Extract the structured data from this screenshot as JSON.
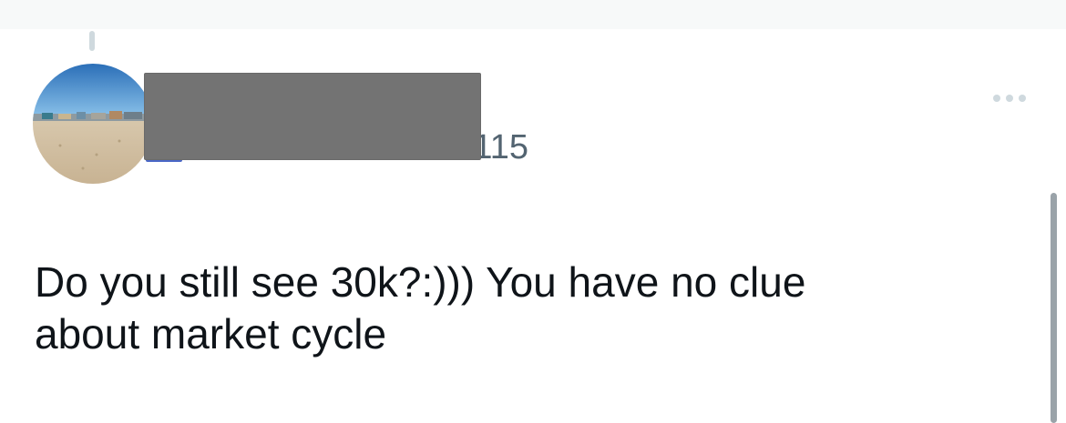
{
  "tweet": {
    "handle_suffix": "115",
    "text_lines": [
      "Do you still see 30k?:))) You have no clue",
      "about market cycle"
    ]
  },
  "icons": {
    "more": "more-horizontal-icon",
    "avatar": "beach-photo-avatar"
  },
  "colors": {
    "text": "#0f1419",
    "secondary": "#536471",
    "thread_line": "#cfd9de",
    "redaction": "#737373",
    "scrollbar": "#9aa3a9"
  }
}
